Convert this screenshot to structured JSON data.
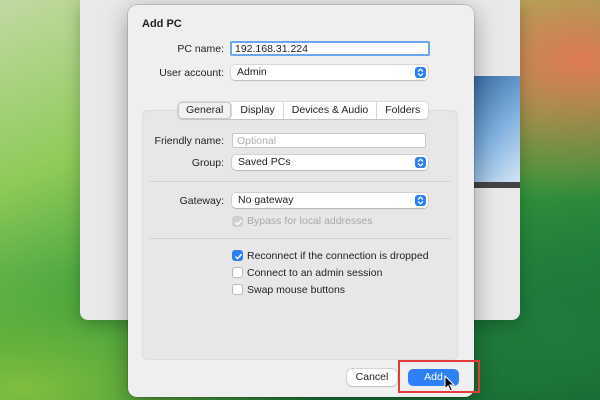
{
  "dialog": {
    "title": "Add PC",
    "pc_name_label": "PC name:",
    "pc_name_value": "192.168.31.224",
    "user_account_label": "User account:",
    "user_account_value": "Admin"
  },
  "tabs": [
    {
      "label": "General",
      "active": true
    },
    {
      "label": "Display",
      "active": false
    },
    {
      "label": "Devices & Audio",
      "active": false
    },
    {
      "label": "Folders",
      "active": false
    }
  ],
  "general": {
    "friendly_name_label": "Friendly name:",
    "friendly_name_placeholder": "Optional",
    "group_label": "Group:",
    "group_value": "Saved PCs",
    "gateway_label": "Gateway:",
    "gateway_value": "No gateway",
    "bypass_label": "Bypass for local addresses",
    "bypass_checked": true,
    "bypass_enabled": false,
    "options": [
      {
        "label": "Reconnect if the connection is dropped",
        "checked": true
      },
      {
        "label": "Connect to an admin session",
        "checked": false
      },
      {
        "label": "Swap mouse buttons",
        "checked": false
      }
    ]
  },
  "buttons": {
    "cancel": "Cancel",
    "add": "Add"
  },
  "colors": {
    "accent": "#2f7ff6",
    "highlight": "#e23a3a"
  }
}
